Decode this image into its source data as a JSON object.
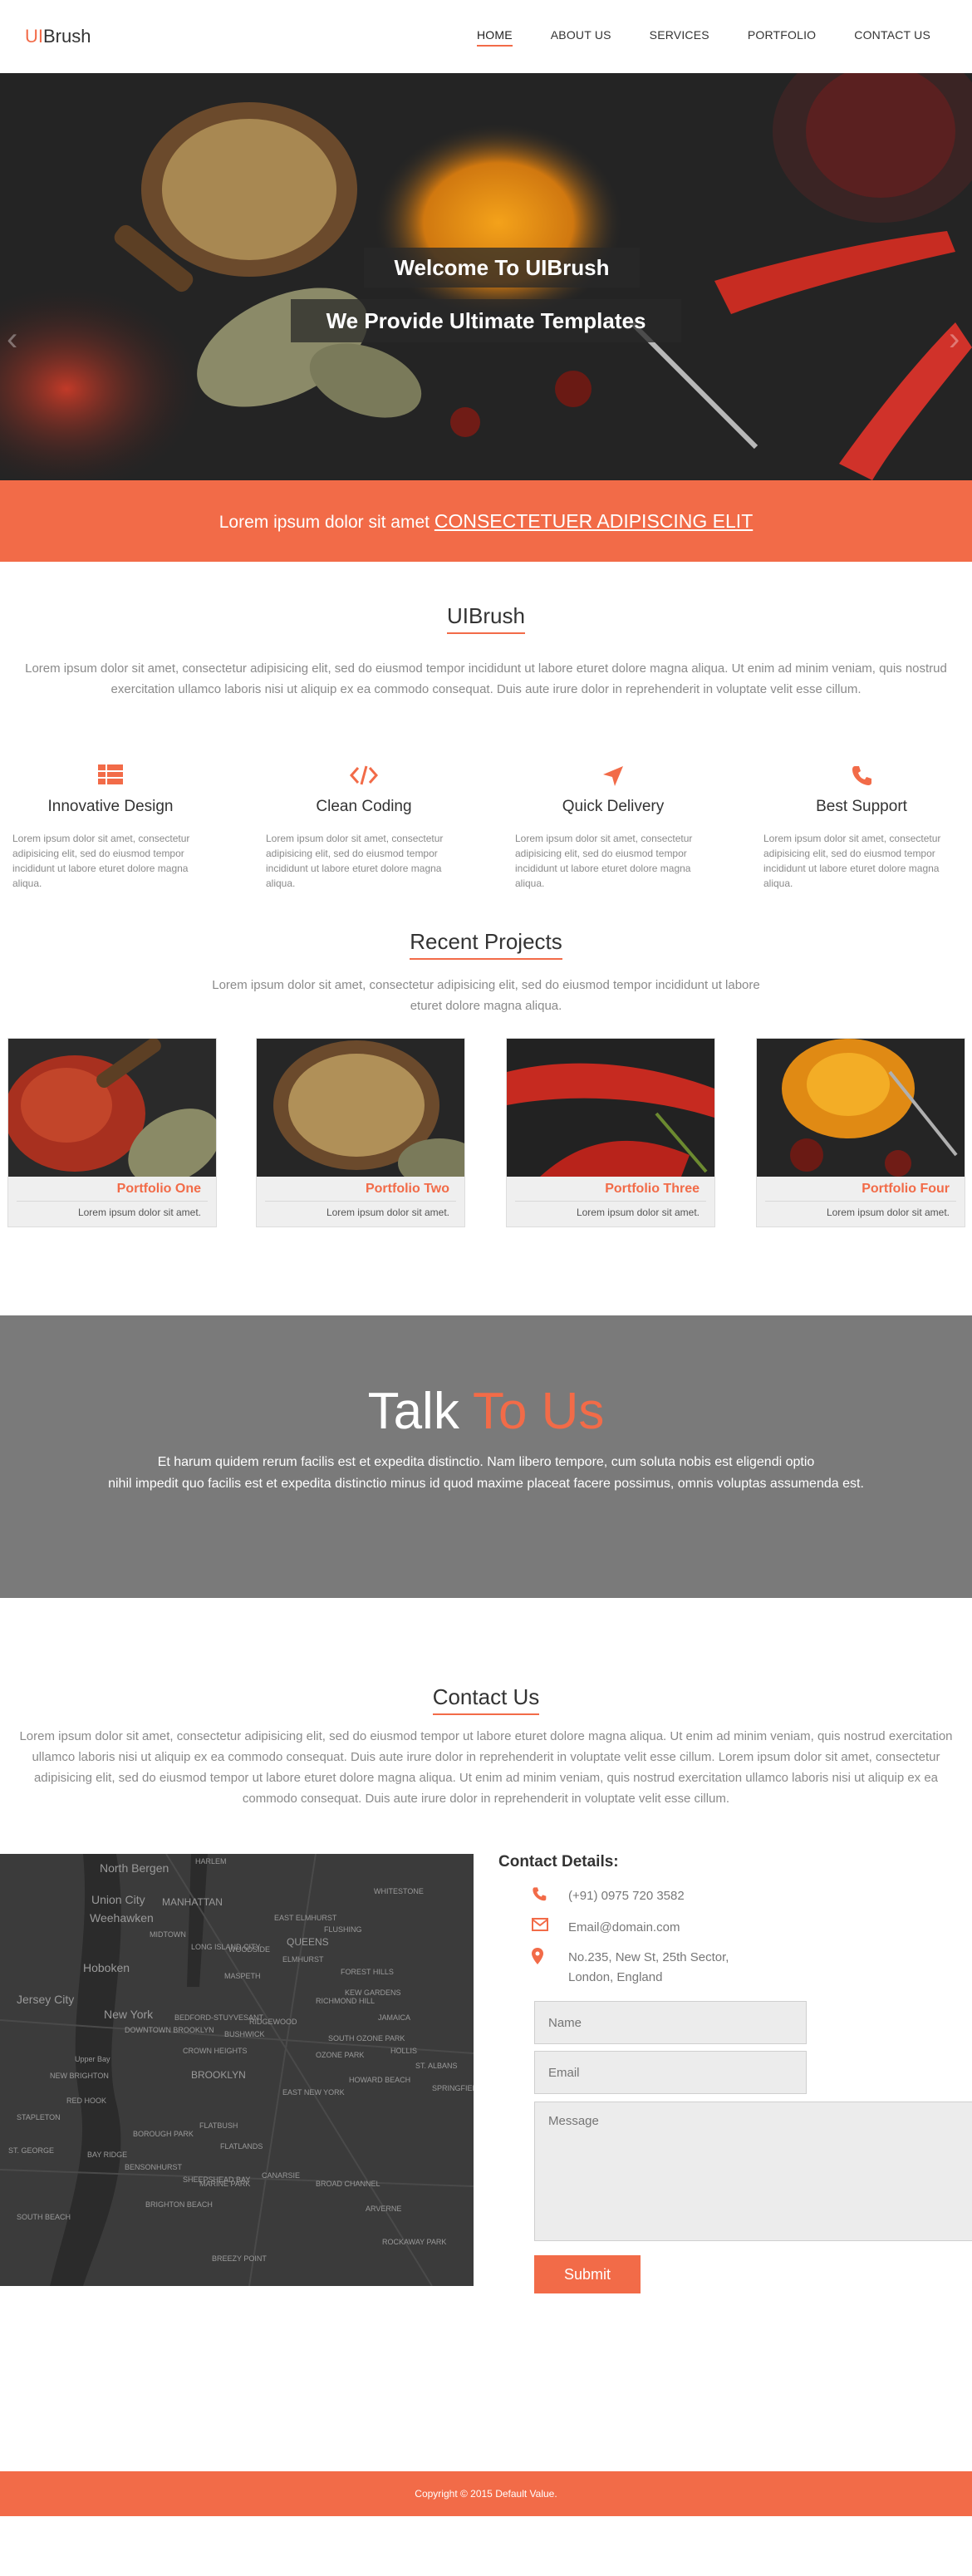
{
  "nav": {
    "logo_accent": "UI",
    "logo_rest": "Brush",
    "items": [
      "HOME",
      "ABOUT US",
      "SERVICES",
      "PORTFOLIO",
      "CONTACT US"
    ]
  },
  "hero": {
    "title": "Welcome To UIBrush",
    "subtitle": "We Provide Ultimate Templates",
    "prev_icon": "chevron-left-icon",
    "next_icon": "chevron-right-icon"
  },
  "banner": {
    "text": "Lorem ipsum dolor sit amet",
    "link": "CONSECTETUER ADIPISCING ELIT"
  },
  "about": {
    "title": "UIBrush",
    "text": "Lorem ipsum dolor sit amet, consectetur adipisicing elit, sed do eiusmod tempor incididunt ut labore eturet dolore magna aliqua. Ut enim ad minim veniam, quis nostrud exercitation ullamco laboris nisi ut aliquip ex ea commodo consequat. Duis aute irure dolor in reprehenderit in voluptate velit esse cillum."
  },
  "features": [
    {
      "icon": "table-icon",
      "name": "Innovative Design",
      "text": "Lorem ipsum dolor sit amet, consectetur adipisicing elit, sed do eiusmod tempor incididunt ut labore eturet dolore magna aliqua."
    },
    {
      "icon": "code-icon",
      "name": "Clean Coding",
      "text": "Lorem ipsum dolor sit amet, consectetur adipisicing elit, sed do eiusmod tempor incididunt ut labore eturet dolore magna aliqua."
    },
    {
      "icon": "location-arrow-icon",
      "name": "Quick Delivery",
      "text": "Lorem ipsum dolor sit amet, consectetur adipisicing elit, sed do eiusmod tempor incididunt ut labore eturet dolore magna aliqua."
    },
    {
      "icon": "phone-icon",
      "name": "Best Support",
      "text": "Lorem ipsum dolor sit amet, consectetur adipisicing elit, sed do eiusmod tempor incididunt ut labore eturet dolore magna aliqua."
    }
  ],
  "projects": {
    "title": "Recent Projects",
    "text": "Lorem ipsum dolor sit amet, consectetur adipisicing elit, sed do eiusmod tempor incididunt ut labore eturet dolore magna aliqua.",
    "items": [
      {
        "name": "Portfolio One",
        "desc": "Lorem ipsum dolor sit amet."
      },
      {
        "name": "Portfolio Two",
        "desc": "Lorem ipsum dolor sit amet."
      },
      {
        "name": "Portfolio Three",
        "desc": "Lorem ipsum dolor sit amet."
      },
      {
        "name": "Portfolio Four",
        "desc": "Lorem ipsum dolor sit amet."
      }
    ]
  },
  "talk": {
    "title_white": "Talk",
    "title_accent": "To Us",
    "line1": "Et harum quidem rerum facilis est et expedita distinctio. Nam libero tempore, cum soluta nobis est eligendi optio",
    "line2": "nihil impedit quo facilis est et expedita distinctio minus id quod maxime placeat facere possimus, omnis voluptas assumenda est."
  },
  "contact": {
    "title": "Contact Us",
    "text": "Lorem ipsum dolor sit amet, consectetur adipisicing elit, sed do eiusmod tempor  ut labore eturet dolore magna aliqua. Ut enim ad minim veniam, quis nostrud exercitation ullamco laboris nisi ut aliquip ex ea commodo consequat. Duis aute irure dolor in reprehenderit in voluptate velit esse cillum.  Lorem ipsum dolor sit amet, consectetur adipisicing elit, sed do eiusmod tempor  ut labore eturet dolore magna aliqua. Ut enim ad minim veniam, quis nostrud exercitation ullamco laboris nisi ut aliquip ex ea commodo consequat. Duis aute irure dolor in reprehenderit in voluptate velit esse cillum.",
    "details_title": "Contact Details:",
    "phone": "(+91) 0975 720 3582",
    "email": "Email@domain.com",
    "address_line1": "No.235, New St, 25th Sector,",
    "address_line2": "London, England",
    "placeholder_name": "Name",
    "placeholder_email": "Email",
    "placeholder_message": "Message",
    "submit": "Submit"
  },
  "map": {
    "labels": [
      "North Bergen",
      "Union City",
      "Weehawken",
      "MANHATTAN",
      "Hoboken",
      "Jersey City",
      "New York",
      "QUEENS",
      "BROOKLYN",
      "Upper Bay",
      "HARLEM",
      "WHITESTONE",
      "EAST ELMHURST",
      "MIDTOWN",
      "FLUSHING",
      "LONG ISLAND CITY",
      "WOODSIDE",
      "ELMHURST",
      "MASPETH",
      "BEDFORD-STUYVESANT",
      "BUSHWICK",
      "CROWN HEIGHTS",
      "EAST NEW YORK",
      "FLATBUSH",
      "FLATLANDS",
      "BOROUGH PARK",
      "BAY RIDGE",
      "CANARSIE",
      "BENSONHURST",
      "SHEEPSHEAD BAY",
      "BRIGHTON BEACH",
      "MARINE PARK",
      "SOUTH OZONE PARK",
      "JAMAICA",
      "HOLLIS",
      "ST. ALBANS",
      "BROAD CHANNEL",
      "ARVERNE",
      "BREEZY POINT",
      "NEW BRIGHTON",
      "STAPLETON",
      "SOUTH BEACH",
      "ST. GEORGE",
      "DOWNTOWN BROOKLYN",
      "RED HOOK",
      "RIDGEWOOD",
      "FOREST HILLS",
      "KEW GARDENS",
      "RICHMOND HILL",
      "OZONE PARK",
      "HOWARD BEACH",
      "SPRINGFIELD GARDENS",
      "ROCKAWAY PARK"
    ]
  },
  "footer": {
    "text": "Copyright © 2015 Default Value."
  },
  "colors": {
    "accent": "#f26b48",
    "talk_bg": "#7a7a7a",
    "map_bg": "#3a3a3a"
  }
}
